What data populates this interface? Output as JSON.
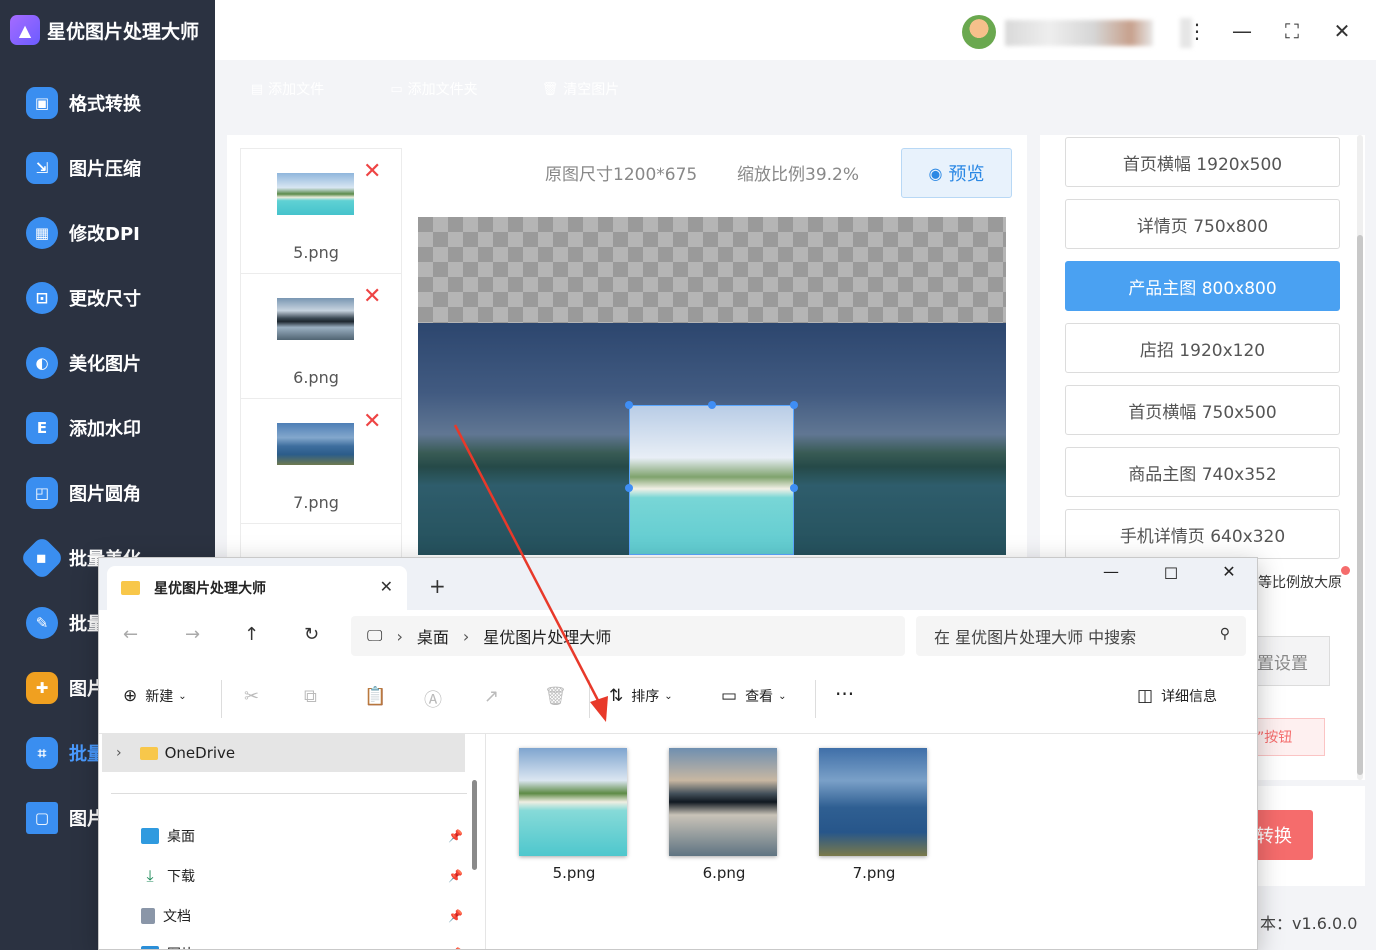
{
  "app": {
    "title": "星优图片处理大师",
    "logo_icon": "mountain-logo-icon"
  },
  "sidebar": {
    "items": [
      {
        "label": "格式转换",
        "icon": "image-convert-icon",
        "color": "#3a8ef0"
      },
      {
        "label": "图片压缩",
        "icon": "compress-icon",
        "color": "#3a8ef0"
      },
      {
        "label": "修改DPI",
        "icon": "dpi-icon",
        "color": "#3a8ef0"
      },
      {
        "label": "更改尺寸",
        "icon": "resize-icon",
        "color": "#3a8ef0"
      },
      {
        "label": "美化图片",
        "icon": "beautify-icon",
        "color": "#3a8ef0"
      },
      {
        "label": "添加水印",
        "icon": "watermark-icon",
        "color": "#3a8ef0"
      },
      {
        "label": "图片圆角",
        "icon": "round-corner-icon",
        "color": "#3a8ef0"
      },
      {
        "label": "批量美化",
        "icon": "batch-beautify-icon",
        "color": "#3a8ef0"
      },
      {
        "label": "批量",
        "icon": "batch-edit-icon",
        "color": "#3a8ef0"
      },
      {
        "label": "图片",
        "icon": "puzzle-icon",
        "color": "#f0a020"
      },
      {
        "label": "批量",
        "icon": "batch-crop-icon",
        "color": "#3a8ef0",
        "active": true
      },
      {
        "label": "图片",
        "icon": "frame-icon",
        "color": "#3a8ef0"
      }
    ]
  },
  "toolbar": {
    "add_file": "添加文件",
    "add_folder": "添加文件夹",
    "clear": "清空图片",
    "add_file_color": "#3f9cf5",
    "add_folder_color": "#3f9cf5",
    "clear_color": "#8f959c"
  },
  "thumbnails": [
    {
      "name": "5.png"
    },
    {
      "name": "6.png"
    },
    {
      "name": "7.png"
    }
  ],
  "preview": {
    "orig_size": "原图尺寸1200*675",
    "zoom_ratio": "缩放比例39.2%",
    "preview_label": "预览"
  },
  "presets": [
    {
      "label": "首页横幅 1920x500"
    },
    {
      "label": "详情页 750x800"
    },
    {
      "label": "产品主图 800x800",
      "active": true
    },
    {
      "label": "店招 1920x120"
    },
    {
      "label": "首页横幅 750x500"
    },
    {
      "label": "商品主图 740x352"
    },
    {
      "label": "手机详情页 640x320"
    }
  ],
  "right_partial": {
    "scale_text": "等比例放大原",
    "settings_text": "置设置",
    "hint_text": "”按钮",
    "convert_text": "转换",
    "version_text": "本：v1.6.0.0"
  },
  "explorer": {
    "tab_title": "星优图片处理大师",
    "address": [
      "桌面",
      "星优图片处理大师"
    ],
    "search_placeholder": "在 星优图片处理大师 中搜索",
    "commands": {
      "new": "新建",
      "sort": "排序",
      "view": "查看",
      "details": "详细信息"
    },
    "onedrive": "OneDrive",
    "quick_access": [
      {
        "label": "桌面",
        "icon": "desktop-icon",
        "color": "#2f9adf"
      },
      {
        "label": "下载",
        "icon": "download-icon",
        "color": "#1e8a5a"
      },
      {
        "label": "文档",
        "icon": "document-icon",
        "color": "#8a96a8"
      },
      {
        "label": "图片",
        "icon": "pictures-icon",
        "color": "#2b8fd8"
      }
    ],
    "files": [
      {
        "name": "5.png"
      },
      {
        "name": "6.png"
      },
      {
        "name": "7.png"
      }
    ]
  }
}
